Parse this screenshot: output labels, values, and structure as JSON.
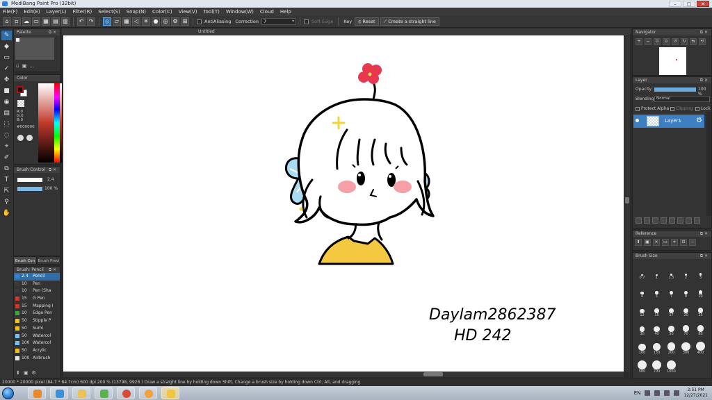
{
  "window": {
    "title": "MediBang Paint Pro (32bit)",
    "min": "–",
    "max": "▢",
    "close": "✕"
  },
  "menu": [
    "File(F)",
    "Edit(E)",
    "Layer(L)",
    "Filter(R)",
    "Select(S)",
    "Snap(N)",
    "Color(C)",
    "View(V)",
    "Tool(T)",
    "Window(W)",
    "Cloud",
    "Help"
  ],
  "toolbar": {
    "antialiasing": "AntiAliasing",
    "correction_label": "Correction",
    "correction_value": "7",
    "soft_edge": "Soft Edge",
    "key": "Key",
    "reset": "Reset",
    "straight_line": "Create a straight line"
  },
  "tools": [
    "✎",
    "◆",
    "▭",
    "✓",
    "✥",
    "■",
    "◉",
    "▤",
    "⬚",
    "◌",
    "⌖",
    "✐",
    "⧉",
    "T",
    "⇱",
    "⚲",
    "✋"
  ],
  "panels": {
    "palette": {
      "title": "Palette",
      "more": "..."
    },
    "color": {
      "title": "Color",
      "r": "R:0",
      "g": "G:0",
      "b": "B:0",
      "hex": "#000000"
    },
    "brush_control": {
      "title": "Brush Control",
      "size": "2.4",
      "opacity": "100 %",
      "opacity_fraction": 1.0
    },
    "brush_tabs": [
      "Brush Con",
      "Brush Previ"
    ],
    "brush_list": {
      "title": "Brush: Pencil",
      "items": [
        {
          "size": "2.4",
          "name": "Pencil",
          "color": "#3a7fd0",
          "selected": true
        },
        {
          "size": "10",
          "name": "Pen",
          "color": "#3a3a3a"
        },
        {
          "size": "10",
          "name": "Pen (Sha",
          "color": "#3a3a3a"
        },
        {
          "size": "15",
          "name": "G Pen",
          "color": "#d9332b"
        },
        {
          "size": "15",
          "name": "Mapping I",
          "color": "#d9332b"
        },
        {
          "size": "10",
          "name": "Edge Pen",
          "color": "#3aaa35"
        },
        {
          "size": "50",
          "name": "Stipple P",
          "color": "#f2c21a"
        },
        {
          "size": "50",
          "name": "Sumi",
          "color": "#f2c21a"
        },
        {
          "size": "50",
          "name": "Watercol",
          "color": "#6fc3ec"
        },
        {
          "size": "100",
          "name": "Watercol",
          "color": "#6fc3ec"
        },
        {
          "size": "50",
          "name": "Acrylic",
          "color": "#f2c21a"
        },
        {
          "size": "100",
          "name": "Airbrush",
          "color": "#e8e8e8"
        }
      ]
    },
    "navigator": {
      "title": "Navigator"
    },
    "layer": {
      "title": "Layer",
      "opacity_label": "Opacity",
      "opacity_value": "100 %",
      "blending_label": "Blending",
      "blending_value": "Normal",
      "protect_alpha": "Protect Alpha",
      "clipping": "Clipping",
      "lock": "Lock",
      "layer_name": "Layer1"
    },
    "reference": {
      "title": "Reference"
    },
    "brush_size": {
      "title": "Brush Size",
      "sizes": [
        "0.7",
        "1",
        "1.5",
        "2",
        "3",
        "4",
        "5",
        "7",
        "8",
        "10",
        "12",
        "15",
        "17",
        "20",
        "25",
        "30",
        "40",
        "50",
        "70",
        "80",
        "100",
        "150",
        "200",
        "300",
        "400",
        "500",
        "700",
        "1000"
      ]
    }
  },
  "document": {
    "tab": "Untitled",
    "signature_line1": "Daylam2862387",
    "signature_line2": "HD 242"
  },
  "status": "20000 * 20000 pixel  (84.7 * 84.7cm)  600 dpi  200 %  (13798, 9928 )   Draw a straight line by holding down Shift, Change a brush size by holding down Ctrl, Alt, and dragging",
  "taskbar": {
    "lang": "EN",
    "time": "2:51 PM",
    "date": "12/27/2021"
  },
  "colors": {
    "accent": "#2f6ea8",
    "layer_selected": "#3d7fc1",
    "flower": "#e8384f",
    "bow": "#a9dcf4",
    "shirt": "#f5c842",
    "cheek": "#f4a0a6"
  }
}
